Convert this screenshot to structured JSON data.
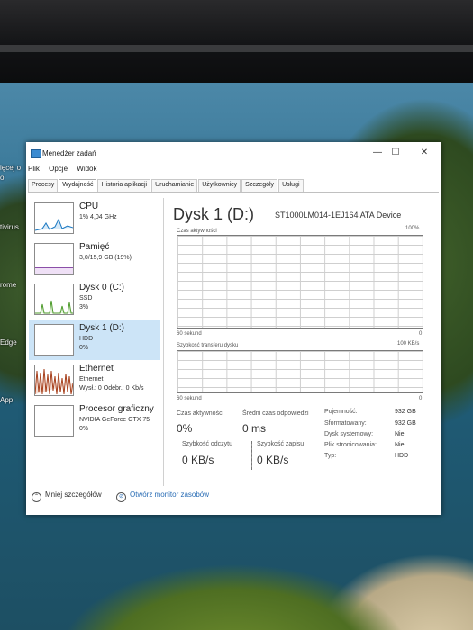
{
  "window": {
    "title": "Menedżer zadań",
    "controls": {
      "minimize": "—",
      "maximize": "☐",
      "close": "✕"
    }
  },
  "menu": [
    "Plik",
    "Opcje",
    "Widok"
  ],
  "tabs": [
    "Procesy",
    "Wydajność",
    "Historia aplikacji",
    "Uruchamianie",
    "Użytkownicy",
    "Szczegóły",
    "Usługi"
  ],
  "active_tab": "Wydajność",
  "desktop_labels": [
    "ięcej o",
    "o",
    "tivirus",
    "rome",
    "Edge",
    "App"
  ],
  "devices": [
    {
      "name": "CPU",
      "line1": "1% 4,04 GHz",
      "line2": "",
      "graph_color": "#1a78c2"
    },
    {
      "name": "Pamięć",
      "line1": "3,0/15,9 GB (19%)",
      "line2": "",
      "graph_color": "#8b4ea8"
    },
    {
      "name": "Dysk 0 (C:)",
      "line1": "SSD",
      "line2": "3%",
      "graph_color": "#4c9a2a"
    },
    {
      "name": "Dysk 1 (D:)",
      "line1": "HDD",
      "line2": "0%",
      "graph_color": "#4c9a2a"
    },
    {
      "name": "Ethernet",
      "line1": "Ethernet",
      "line2": "Wysł.: 0 Odebr.: 0 Kb/s",
      "graph_color": "#a7401c"
    },
    {
      "name": "Procesor graficzny",
      "line1": "NVIDIA GeForce GTX 75",
      "line2": "0%",
      "graph_color": "#1a78c2"
    }
  ],
  "detail": {
    "title": "Dysk 1 (D:)",
    "model": "ST1000LM014-1EJ164 ATA Device",
    "graph1": {
      "label": "Czas aktywności",
      "max": "100%",
      "bottom_left": "60 sekund",
      "bottom_right": "0"
    },
    "graph2": {
      "label": "Szybkość transferu dysku",
      "max": "100 KB/s",
      "bottom_left": "60 sekund",
      "bottom_right": "0"
    },
    "stats": {
      "active_label": "Czas aktywności",
      "active_value": "0%",
      "response_label": "Średni czas odpowiedzi",
      "response_value": "0 ms",
      "read_label": "Szybkość odczytu",
      "read_value": "0 KB/s",
      "write_label": "Szybkość zapisu",
      "write_value": "0 KB/s"
    },
    "props": [
      {
        "k": "Pojemność:",
        "v": "932 GB"
      },
      {
        "k": "Sformatowany:",
        "v": "932 GB"
      },
      {
        "k": "Dysk systemowy:",
        "v": "Nie"
      },
      {
        "k": "Plik stronicowania:",
        "v": "Nie"
      },
      {
        "k": "Typ:",
        "v": "HDD"
      }
    ]
  },
  "footer": {
    "less_details": "Mniej szczegółów",
    "open_monitor": "Otwórz monitor zasobów"
  }
}
